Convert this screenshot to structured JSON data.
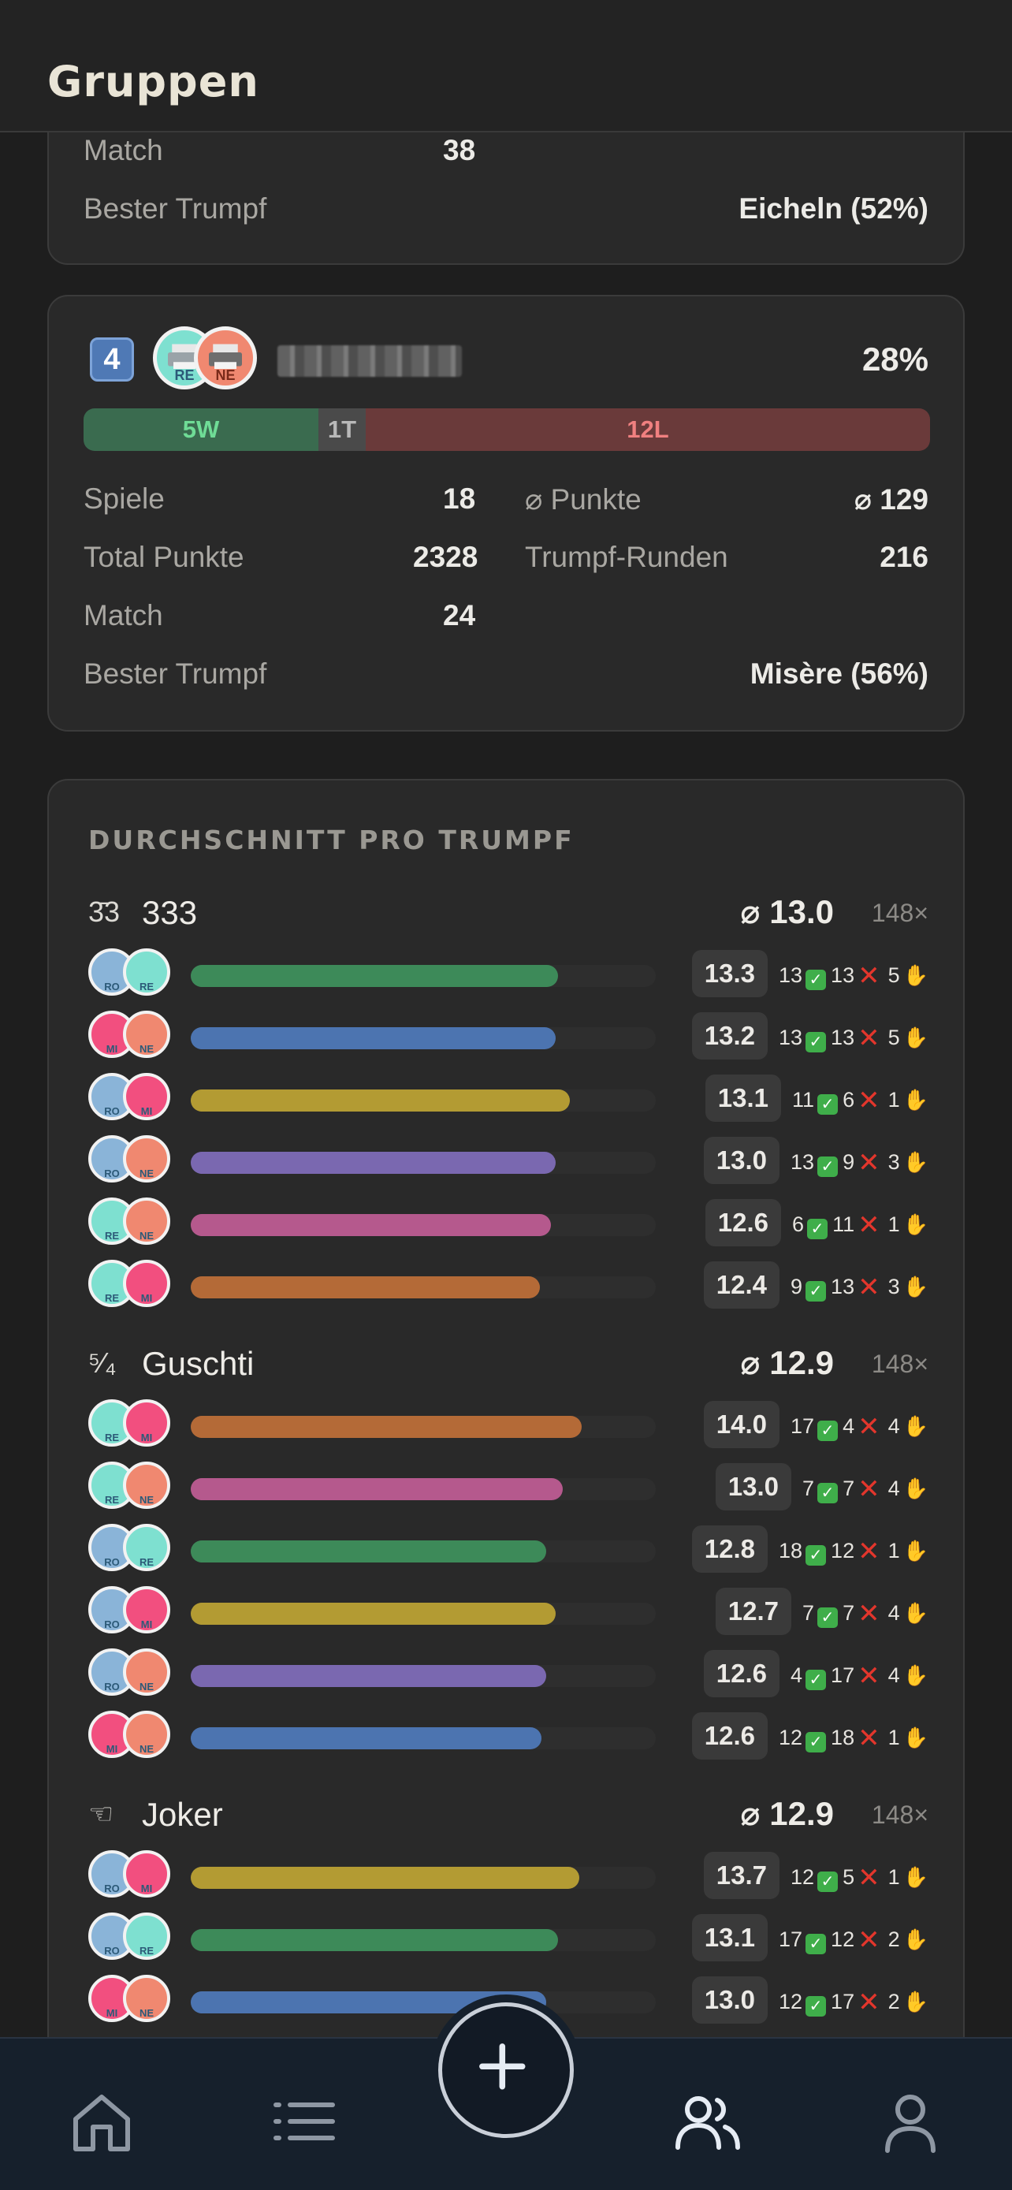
{
  "header": {
    "title": "Gruppen"
  },
  "prev_card": {
    "rows": [
      {
        "label": "Match",
        "value": "38"
      },
      {
        "label": "Bester Trumpf",
        "value": "Eicheln (52%)"
      }
    ]
  },
  "group": {
    "rank": "4",
    "percent": "28%",
    "wins_label": "5W",
    "ties_label": "1T",
    "losses_label": "12L",
    "wins": 5,
    "ties": 1,
    "losses": 12,
    "players": [
      {
        "code": "RE",
        "bg": "#7ee0d0",
        "icon": "printer-icon"
      },
      {
        "code": "NE",
        "bg": "#f08870",
        "icon": "printer-icon"
      }
    ],
    "stats_left": [
      {
        "label": "Spiele",
        "value": "18"
      },
      {
        "label": "Total Punkte",
        "value": "2328"
      },
      {
        "label": "Match",
        "value": "24"
      }
    ],
    "stats_right": [
      {
        "label": "⌀ Punkte",
        "value": "⌀ 129"
      },
      {
        "label": "Trumpf-Runden",
        "value": "216"
      }
    ],
    "best_trump_label": "Bester Trumpf",
    "best_trump_value": "Misère (56%)"
  },
  "averages": {
    "title": "DURCHSCHNITT PRO TRUMPF",
    "colors": {
      "green": "#3d8a59",
      "blue": "#4c74b0",
      "yellow": "#b39b33",
      "purple": "#7a68b0",
      "pink": "#b5598d",
      "orange": "#b46a37"
    },
    "avatars": {
      "RO": {
        "bg": "#8ab4d8",
        "code": "RO"
      },
      "RE": {
        "bg": "#7ee0d0",
        "code": "RE"
      },
      "NE": {
        "bg": "#f08870",
        "code": "NE"
      },
      "MI": {
        "bg": "#f24f7f",
        "code": "MI"
      }
    },
    "trumps": [
      {
        "icon": "3̄3",
        "name": "333",
        "avg": "⌀ 13.0",
        "count": "148×",
        "rows": [
          {
            "p1": "RO",
            "p2": "RE",
            "fill": 0.79,
            "color": "green",
            "score": "13.3",
            "w": "13",
            "l": "13",
            "t": "5"
          },
          {
            "p1": "MI",
            "p2": "NE",
            "fill": 0.785,
            "color": "blue",
            "score": "13.2",
            "w": "13",
            "l": "13",
            "t": "5"
          },
          {
            "p1": "RO",
            "p2": "MI",
            "fill": 0.815,
            "color": "yellow",
            "score": "13.1",
            "w": "11",
            "l": "6",
            "t": "1"
          },
          {
            "p1": "RO",
            "p2": "NE",
            "fill": 0.785,
            "color": "purple",
            "score": "13.0",
            "w": "13",
            "l": "9",
            "t": "3"
          },
          {
            "p1": "RE",
            "p2": "NE",
            "fill": 0.775,
            "color": "pink",
            "score": "12.6",
            "w": "6",
            "l": "11",
            "t": "1"
          },
          {
            "p1": "RE",
            "p2": "MI",
            "fill": 0.75,
            "color": "orange",
            "score": "12.4",
            "w": "9",
            "l": "13",
            "t": "3"
          }
        ]
      },
      {
        "icon": "⁵⁄₄",
        "name": "Guschti",
        "avg": "⌀ 12.9",
        "count": "148×",
        "rows": [
          {
            "p1": "RE",
            "p2": "MI",
            "fill": 0.84,
            "color": "orange",
            "score": "14.0",
            "w": "17",
            "l": "4",
            "t": "4"
          },
          {
            "p1": "RE",
            "p2": "NE",
            "fill": 0.8,
            "color": "pink",
            "score": "13.0",
            "w": "7",
            "l": "7",
            "t": "4"
          },
          {
            "p1": "RO",
            "p2": "RE",
            "fill": 0.765,
            "color": "green",
            "score": "12.8",
            "w": "18",
            "l": "12",
            "t": "1"
          },
          {
            "p1": "RO",
            "p2": "MI",
            "fill": 0.785,
            "color": "yellow",
            "score": "12.7",
            "w": "7",
            "l": "7",
            "t": "4"
          },
          {
            "p1": "RO",
            "p2": "NE",
            "fill": 0.765,
            "color": "purple",
            "score": "12.6",
            "w": "4",
            "l": "17",
            "t": "4"
          },
          {
            "p1": "MI",
            "p2": "NE",
            "fill": 0.755,
            "color": "blue",
            "score": "12.6",
            "w": "12",
            "l": "18",
            "t": "1"
          }
        ]
      },
      {
        "icon": "☜",
        "name": "Joker",
        "avg": "⌀ 12.9",
        "count": "148×",
        "rows": [
          {
            "p1": "RO",
            "p2": "MI",
            "fill": 0.835,
            "color": "yellow",
            "score": "13.7",
            "w": "12",
            "l": "5",
            "t": "1"
          },
          {
            "p1": "RO",
            "p2": "RE",
            "fill": 0.79,
            "color": "green",
            "score": "13.1",
            "w": "17",
            "l": "12",
            "t": "2"
          },
          {
            "p1": "MI",
            "p2": "NE",
            "fill": 0.765,
            "color": "blue",
            "score": "13.0",
            "w": "12",
            "l": "17",
            "t": "2"
          }
        ]
      }
    ]
  },
  "nav": {
    "items": [
      {
        "name": "home",
        "icon": "home-icon"
      },
      {
        "name": "list",
        "icon": "list-icon"
      },
      {
        "name": "add",
        "icon": "plus-icon"
      },
      {
        "name": "groups",
        "icon": "groups-icon",
        "active": true
      },
      {
        "name": "profile",
        "icon": "profile-icon"
      }
    ]
  }
}
